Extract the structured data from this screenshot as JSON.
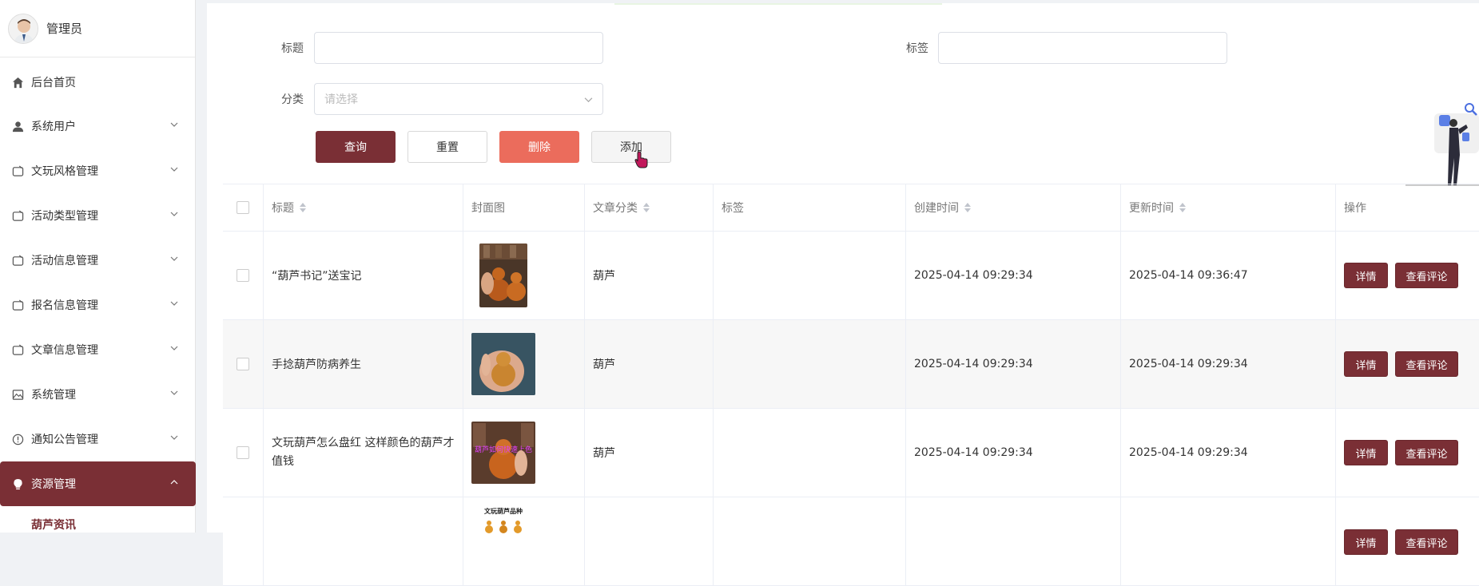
{
  "sidebar": {
    "user": "管理员",
    "items": [
      {
        "label": "后台首页",
        "icon": "home-icon"
      },
      {
        "label": "系统用户",
        "icon": "user-icon"
      },
      {
        "label": "文玩风格管理",
        "icon": "folder-icon"
      },
      {
        "label": "活动类型管理",
        "icon": "folder-icon"
      },
      {
        "label": "活动信息管理",
        "icon": "folder-icon"
      },
      {
        "label": "报名信息管理",
        "icon": "folder-icon"
      },
      {
        "label": "文章信息管理",
        "icon": "folder-icon"
      },
      {
        "label": "系统管理",
        "icon": "image-icon"
      },
      {
        "label": "通知公告管理",
        "icon": "info-circle-icon"
      },
      {
        "label": "资源管理",
        "icon": "bulb-icon"
      }
    ],
    "active_sub": "葫芦资讯"
  },
  "filters": {
    "title_label": "标题",
    "tag_label": "标签",
    "category_label": "分类",
    "category_placeholder": "请选择",
    "title_value": "",
    "tag_value": ""
  },
  "buttons": {
    "query": "查询",
    "reset": "重置",
    "delete": "删除",
    "add": "添加"
  },
  "table": {
    "headers": [
      "标题",
      "封面图",
      "文章分类",
      "标签",
      "创建时间",
      "更新时间",
      "操作"
    ],
    "rows": [
      {
        "title": "“葫芦书记”送宝记",
        "category": "葫芦",
        "tag": "",
        "created": "2025-04-14 09:29:34",
        "updated": "2025-04-14 09:36:47"
      },
      {
        "title": "手捻葫芦防病养生",
        "category": "葫芦",
        "tag": "",
        "created": "2025-04-14 09:29:34",
        "updated": "2025-04-14 09:29:34"
      },
      {
        "title": "文玩葫芦怎么盘红 这样颜色的葫芦才值钱",
        "category": "葫芦",
        "tag": "",
        "created": "2025-04-14 09:29:34",
        "updated": "2025-04-14 09:29:34"
      },
      {
        "title": "",
        "category": "",
        "tag": "",
        "created": "",
        "updated": ""
      }
    ],
    "row_actions": {
      "detail": "详情",
      "comments": "查看评论"
    },
    "thumb_texts": [
      "",
      "",
      "葫芦如何快速上色",
      "文玩葫芦品种"
    ]
  },
  "colors": {
    "primary": "#7a2f35",
    "danger": "#eb6c5c"
  }
}
